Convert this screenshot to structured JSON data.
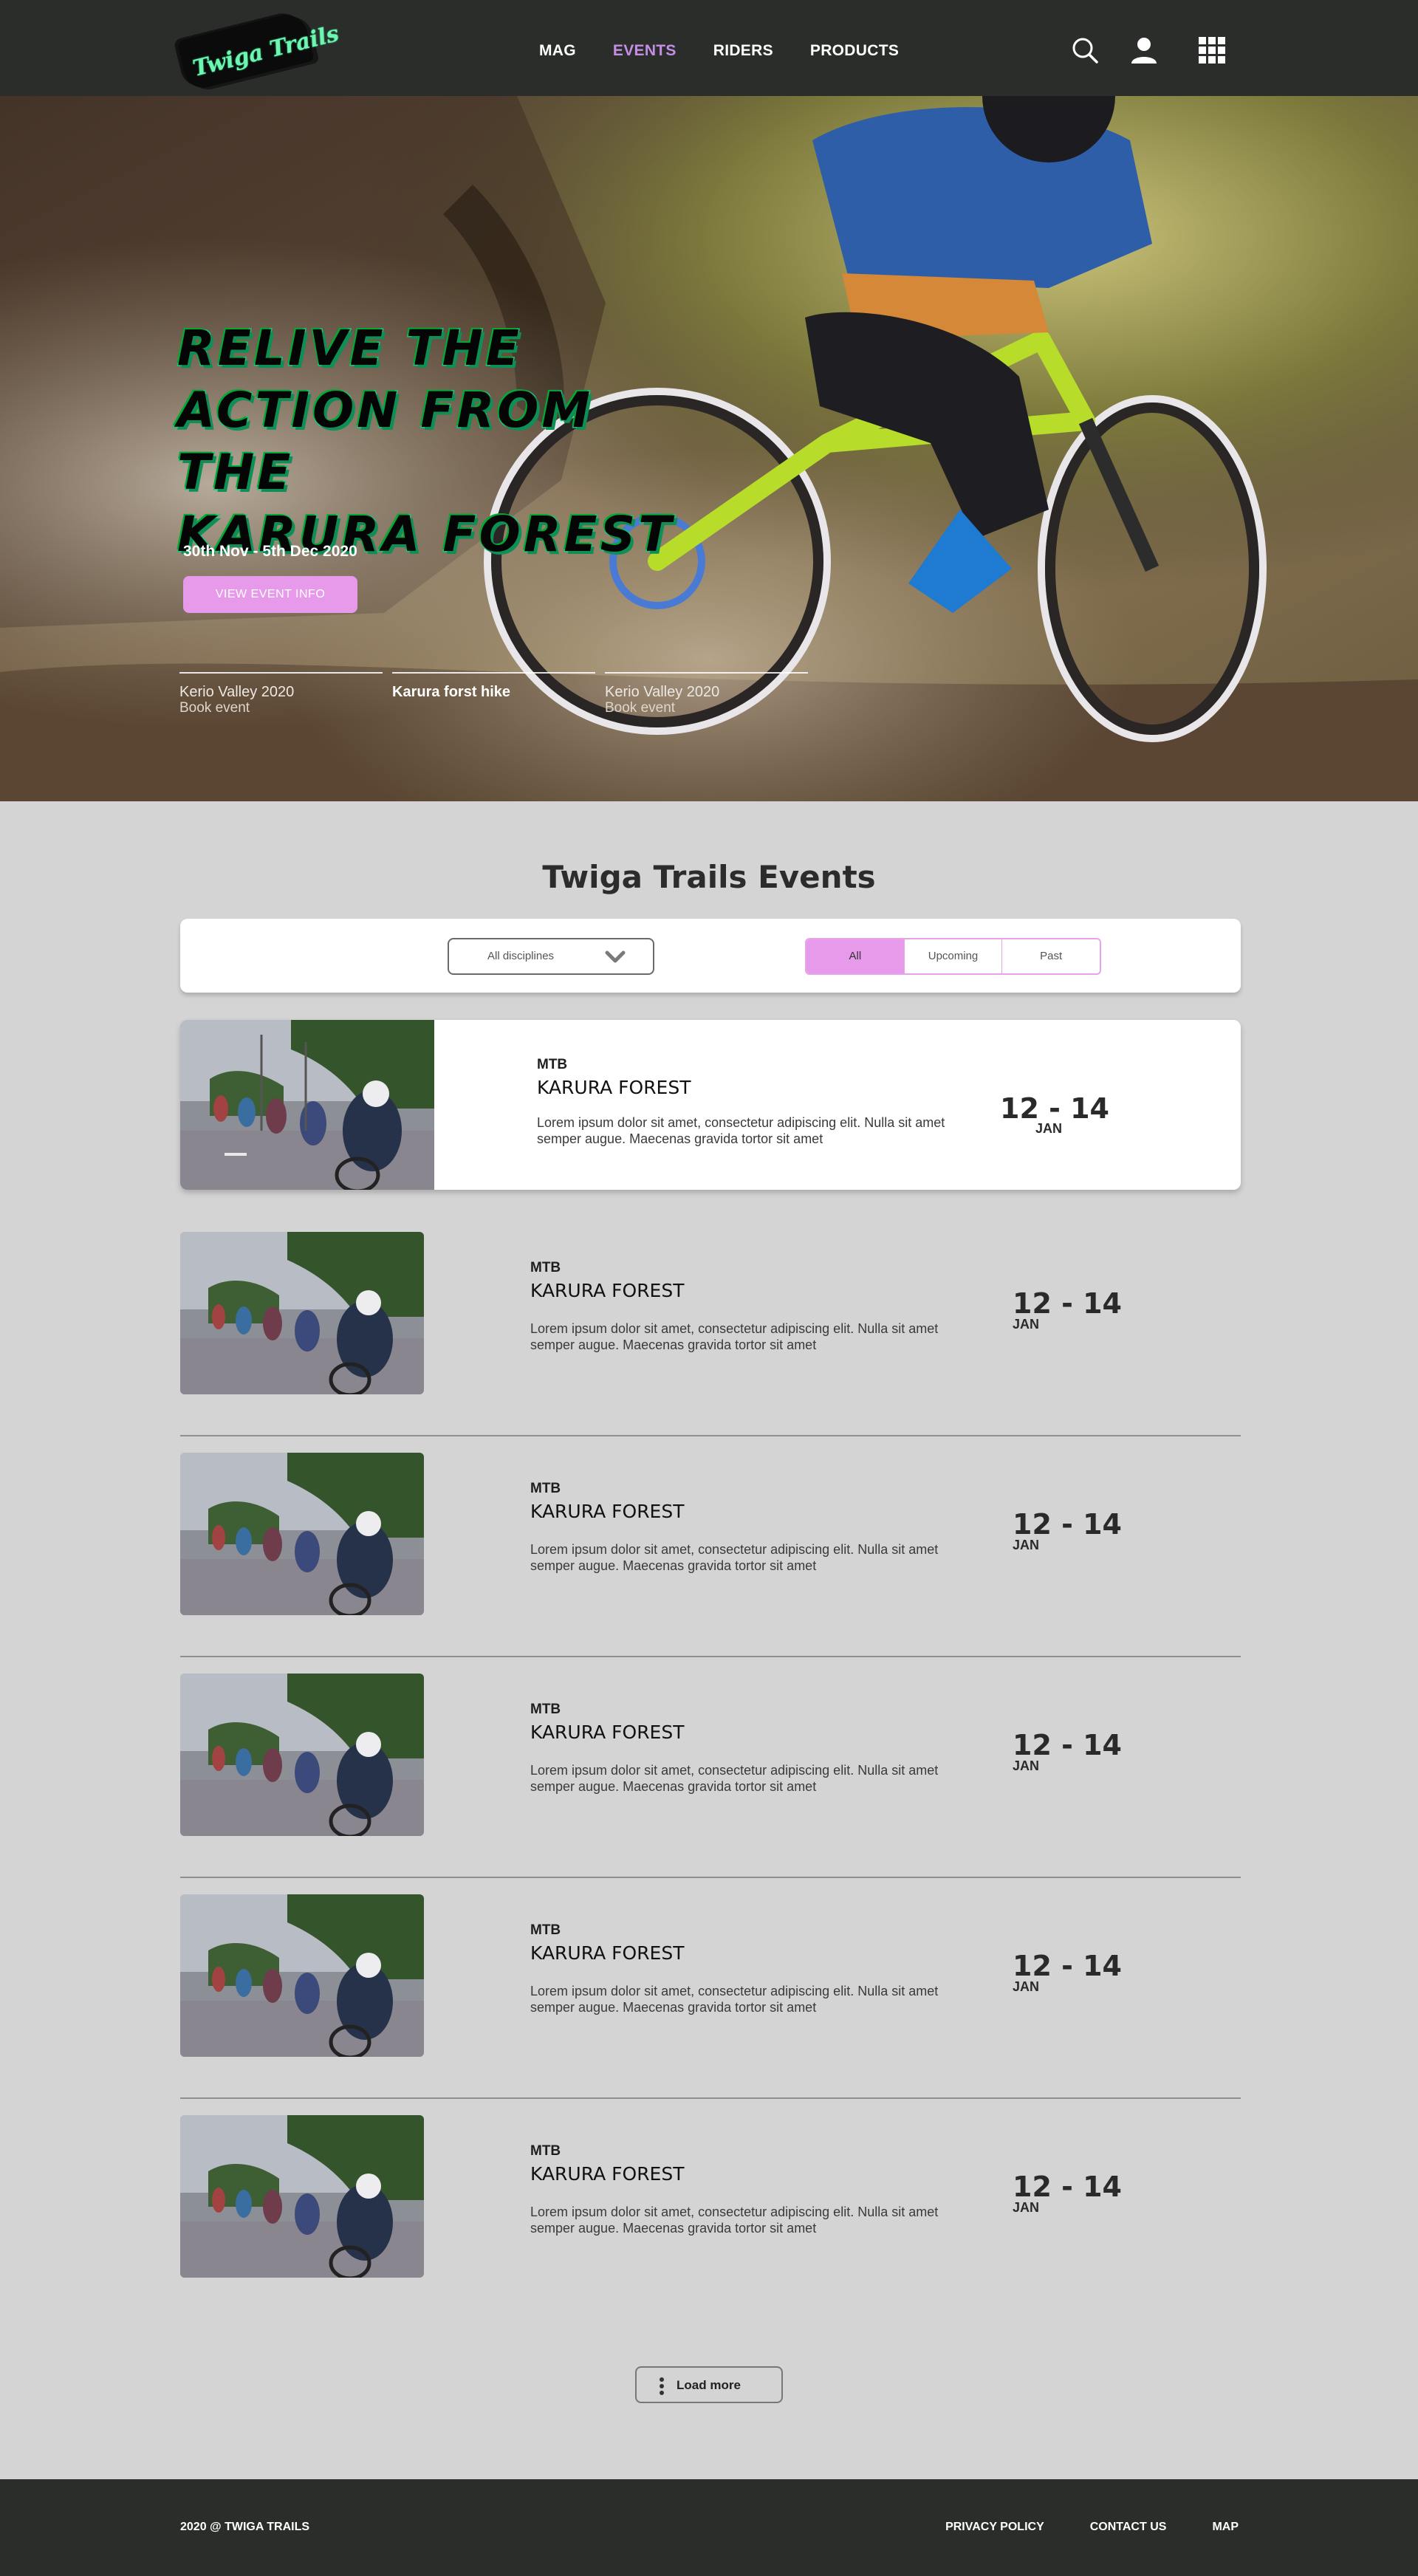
{
  "brand": {
    "logo_text": "Twiga Trails"
  },
  "nav": {
    "links": [
      {
        "label": "MAG"
      },
      {
        "label": "EVENTS",
        "active": true
      },
      {
        "label": "RIDERS"
      },
      {
        "label": "PRODUCTS"
      }
    ],
    "icons": [
      "search-icon",
      "user-icon",
      "apps-grid-icon"
    ],
    "active_color": "#c48ee6"
  },
  "hero": {
    "title": "RELIVE THE ACTION FROM THE KARURA FOREST",
    "title_lines": [
      "RELIVE THE",
      "ACTION FROM THE",
      "KARURA FOREST"
    ],
    "dates": "30th Nov  - 5th Dec 2020",
    "cta": "VIEW EVENT INFO",
    "tabs": [
      {
        "title": "Kerio Valley 2020",
        "subtitle": "Book event"
      },
      {
        "title": "Karura forst hike",
        "subtitle": "",
        "active": true
      },
      {
        "title": "Kerio Valley 2020",
        "subtitle": "Book event"
      }
    ]
  },
  "events_section": {
    "title": "Twiga Trails Events",
    "filters": {
      "discipline": "All disciplines",
      "segments": [
        "All",
        "Upcoming",
        "Past"
      ],
      "selected": "All"
    },
    "events": [
      {
        "category": "MTB",
        "name": "KARURA FOREST",
        "description": "Lorem ipsum dolor sit amet, consectetur adipiscing elit. Nulla sit amet semper augue. Maecenas gravida tortor sit amet",
        "dates": "12 - 14",
        "month": "JAN"
      },
      {
        "category": "MTB",
        "name": "KARURA FOREST",
        "description": "Lorem ipsum dolor sit amet, consectetur adipiscing elit. Nulla sit amet semper augue. Maecenas gravida tortor sit amet",
        "dates": "12 - 14",
        "month": "JAN"
      },
      {
        "category": "MTB",
        "name": "KARURA FOREST",
        "description": "Lorem ipsum dolor sit amet, consectetur adipiscing elit. Nulla sit amet semper augue. Maecenas gravida tortor sit amet",
        "dates": "12 - 14",
        "month": "JAN"
      },
      {
        "category": "MTB",
        "name": "KARURA FOREST",
        "description": "Lorem ipsum dolor sit amet, consectetur adipiscing elit. Nulla sit amet semper augue. Maecenas gravida tortor sit amet",
        "dates": "12 - 14",
        "month": "JAN"
      },
      {
        "category": "MTB",
        "name": "KARURA FOREST",
        "description": "Lorem ipsum dolor sit amet, consectetur adipiscing elit. Nulla sit amet semper augue. Maecenas gravida tortor sit amet",
        "dates": "12 - 14",
        "month": "JAN"
      },
      {
        "category": "MTB",
        "name": "KARURA FOREST",
        "description": "Lorem ipsum dolor sit amet, consectetur adipiscing elit. Nulla sit amet semper augue. Maecenas gravida tortor sit amet",
        "dates": "12 - 14",
        "month": "JAN"
      }
    ],
    "load_more": "Load more"
  },
  "footer": {
    "copyright": "2020 @ TWIGA TRAILS",
    "links": [
      "PRIVACY POLICY",
      "CONTACT US",
      "MAP"
    ]
  },
  "colors": {
    "accent": "#e79ae9",
    "nav_bg": "#2b2d2a",
    "page_bg": "#d4d4d4",
    "logo_green": "#6ff5b2"
  }
}
